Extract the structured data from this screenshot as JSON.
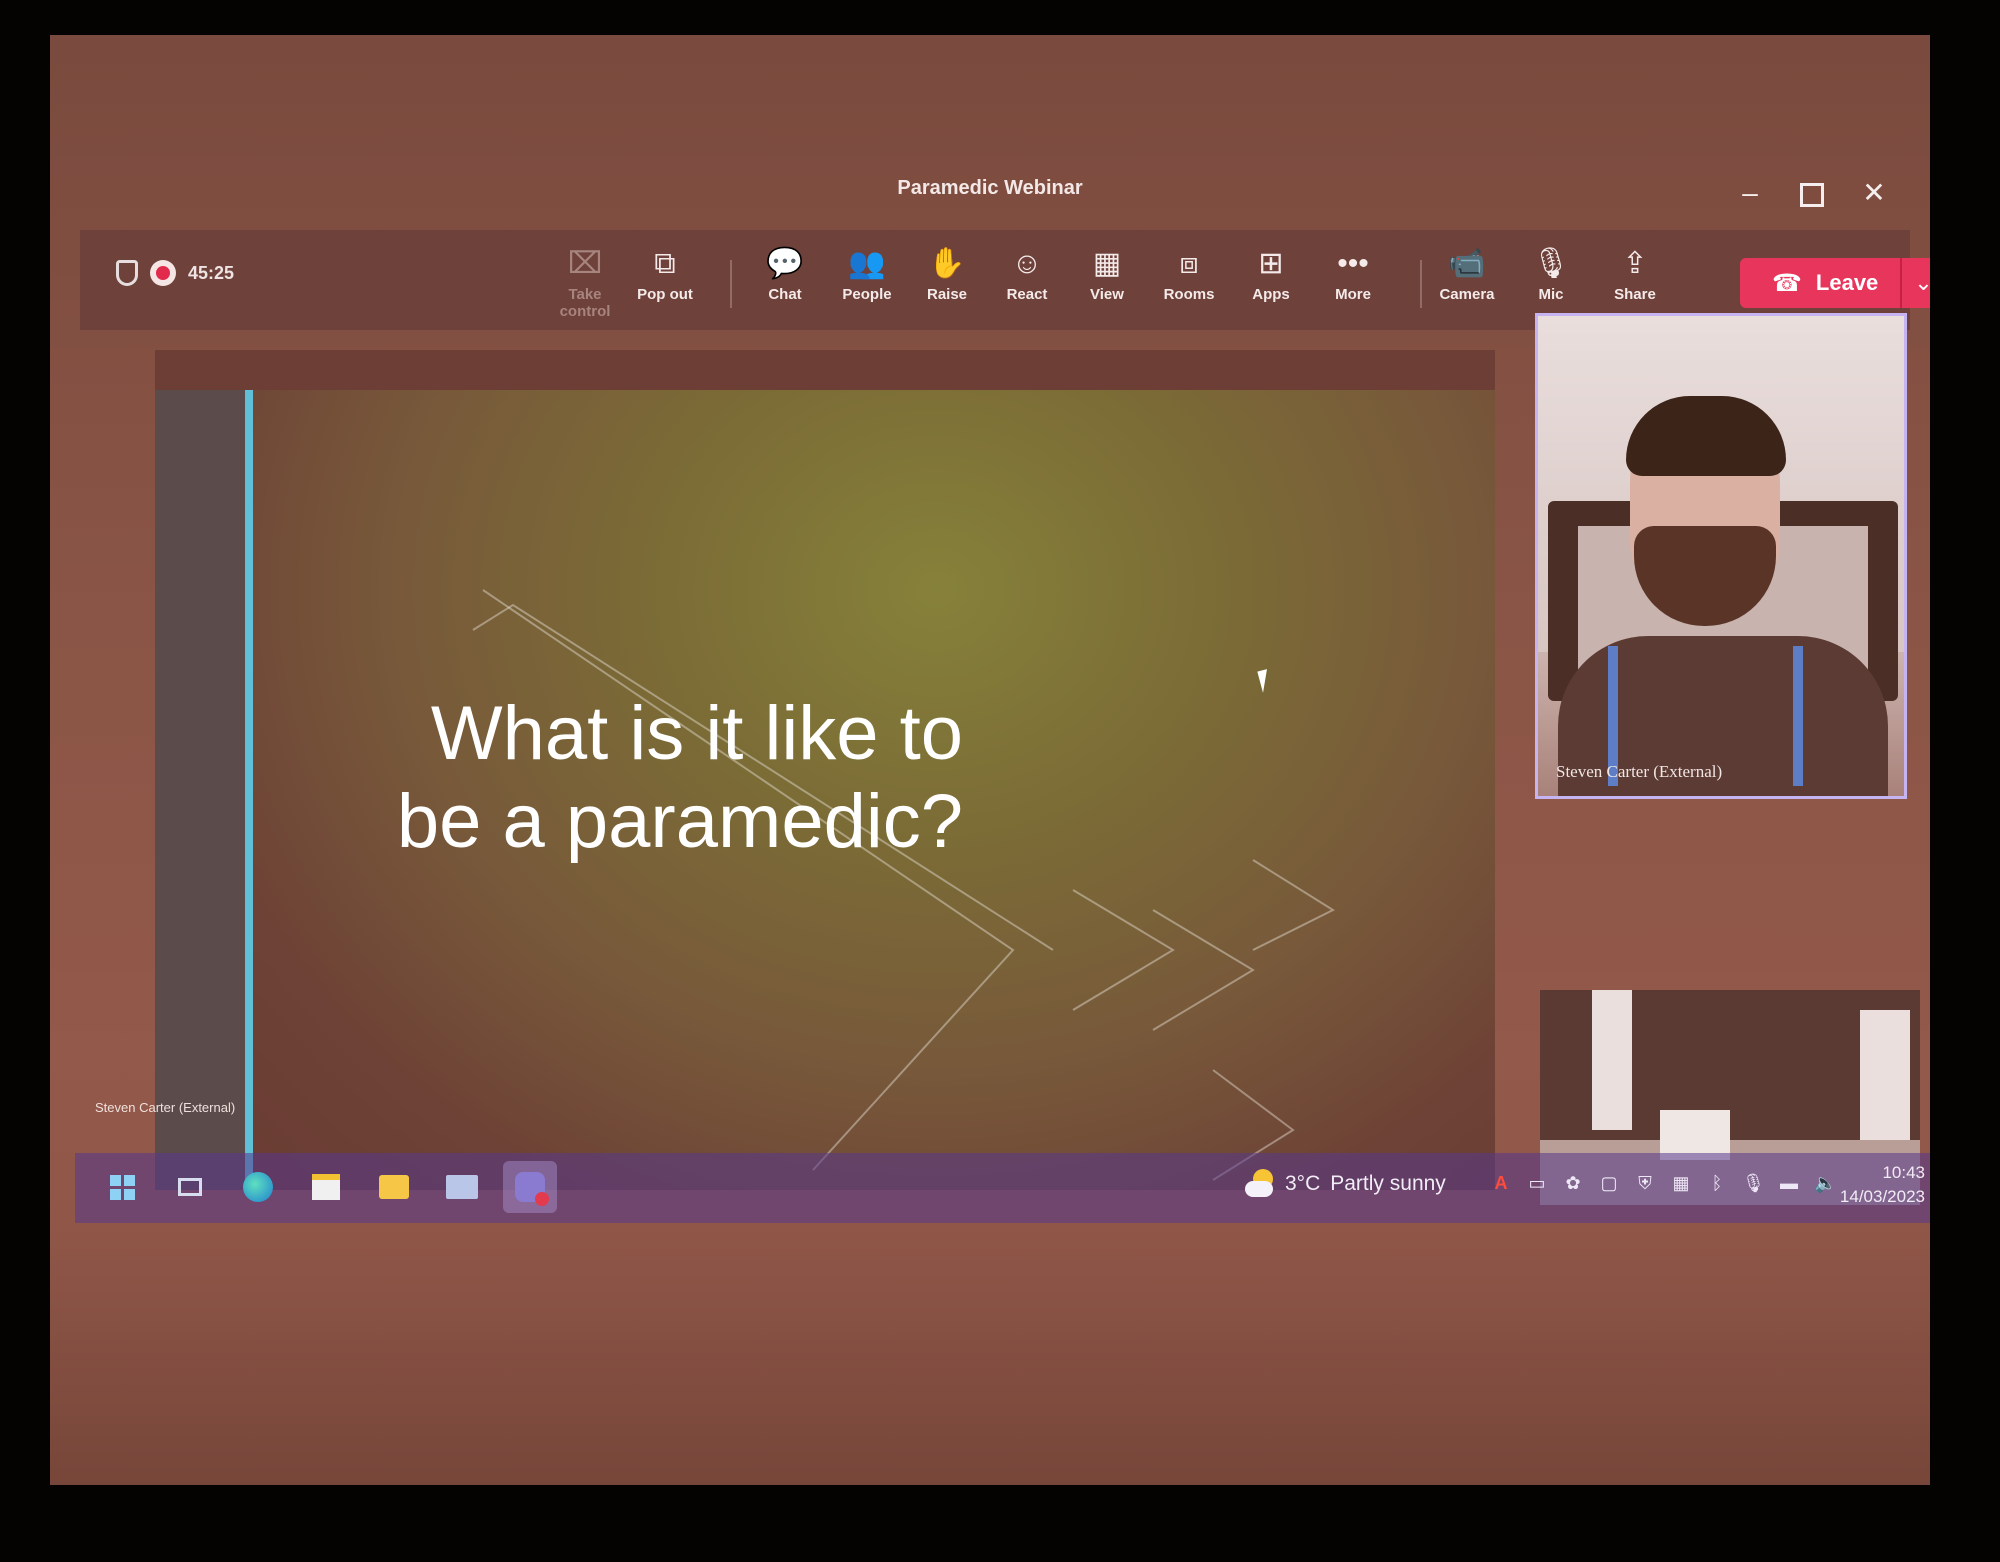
{
  "window": {
    "title": "Paramedic Webinar",
    "controls": {
      "minimize": "–",
      "close": "✕"
    }
  },
  "meeting": {
    "elapsed": "45:25",
    "toolbar": [
      {
        "key": "take-control",
        "label": "Take control",
        "icon": "⌧",
        "disabled": true
      },
      {
        "key": "pop-out",
        "label": "Pop out",
        "icon": "⧉"
      },
      {
        "key": "chat",
        "label": "Chat",
        "icon": "💬"
      },
      {
        "key": "people",
        "label": "People",
        "icon": "👥"
      },
      {
        "key": "raise",
        "label": "Raise",
        "icon": "✋"
      },
      {
        "key": "react",
        "label": "React",
        "icon": "☺"
      },
      {
        "key": "view",
        "label": "View",
        "icon": "▦"
      },
      {
        "key": "rooms",
        "label": "Rooms",
        "icon": "⧈"
      },
      {
        "key": "apps",
        "label": "Apps",
        "icon": "⊞"
      },
      {
        "key": "more",
        "label": "More",
        "icon": "•••"
      },
      {
        "key": "camera",
        "label": "Camera",
        "icon": "📹"
      },
      {
        "key": "mic",
        "label": "Mic",
        "icon": "🎙"
      },
      {
        "key": "share",
        "label": "Share",
        "icon": "⇪"
      }
    ],
    "leave": {
      "label": "Leave",
      "icon": "☎",
      "chevron": "⌄"
    },
    "colors": {
      "leave": "#e8355c",
      "accent": "#5fc0d8",
      "tile_border": "#c6b4f2"
    }
  },
  "slide": {
    "title": "What is it like to be a paramedic?",
    "presenter_caption": "Steven Carter (External)"
  },
  "participants": {
    "main": {
      "name": "Steven Carter (External)"
    }
  },
  "taskbar": {
    "weather": {
      "temp": "3°C",
      "condition": "Partly sunny"
    },
    "tray_icons": [
      "A",
      "▭",
      "✿",
      "▢",
      "⛨",
      "▦",
      "ᛒ",
      "🎙",
      "▬",
      "🔈"
    ],
    "clock": {
      "time": "10:43",
      "date": "14/03/2023"
    }
  }
}
